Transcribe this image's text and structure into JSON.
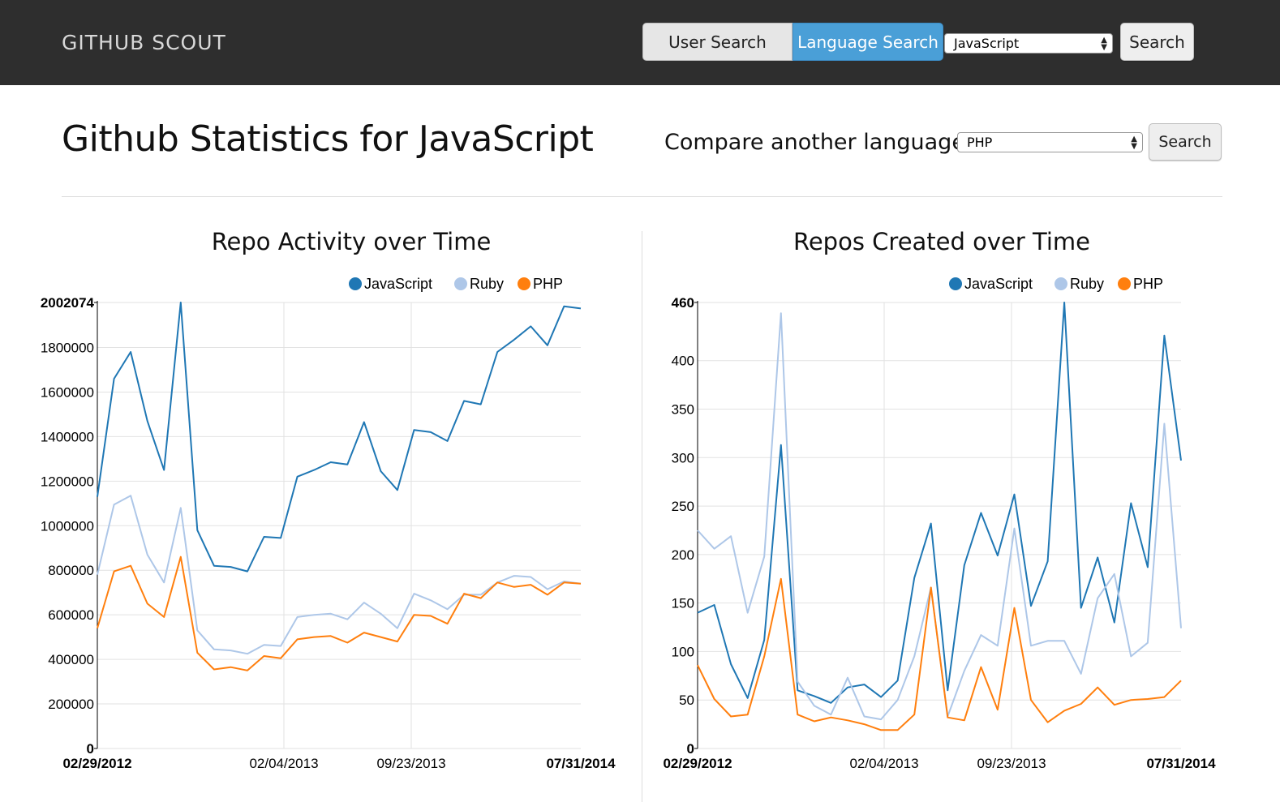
{
  "navbar": {
    "brand": "GITHUB SCOUT",
    "user_search_label": "User Search",
    "language_search_label": "Language Search",
    "language_select_value": "JavaScript",
    "search_button_label": "Search"
  },
  "page": {
    "title": "Github Statistics for JavaScript",
    "compare_label": "Compare another language:",
    "compare_select_value": "PHP",
    "compare_button_label": "Search"
  },
  "colors": {
    "javascript": "#1f77b4",
    "ruby": "#aec7e8",
    "php": "#ff7f0e",
    "navbar": "#2e2e2e",
    "active_tab": "#4a9fd7"
  },
  "chart_data": [
    {
      "type": "line",
      "title": "Repo Activity over Time",
      "legend": [
        "JavaScript",
        "Ruby",
        "PHP"
      ],
      "legend_position": "top-right",
      "ylim": [
        0,
        2002074
      ],
      "y_ticks": [
        "0",
        "200000",
        "400000",
        "600000",
        "800000",
        "1000000",
        "1200000",
        "1400000",
        "1600000",
        "1800000",
        "2002074"
      ],
      "x_ticks": [
        "02/29/2012",
        "02/04/2013",
        "09/23/2013",
        "07/31/2014"
      ],
      "x_points": 30,
      "grid": true,
      "series": [
        {
          "name": "JavaScript",
          "values": [
            1130000,
            1660000,
            1780000,
            1470000,
            1250000,
            2002074,
            980000,
            820000,
            815000,
            795000,
            950000,
            945000,
            1220000,
            1250000,
            1285000,
            1275000,
            1465000,
            1245000,
            1160000,
            1430000,
            1420000,
            1380000,
            1560000,
            1545000,
            1780000,
            1835000,
            1895000,
            1810000,
            1985000,
            1975000
          ]
        },
        {
          "name": "Ruby",
          "values": [
            780000,
            1095000,
            1135000,
            870000,
            745000,
            1080000,
            530000,
            445000,
            440000,
            425000,
            465000,
            460000,
            590000,
            600000,
            605000,
            580000,
            655000,
            605000,
            540000,
            695000,
            665000,
            625000,
            690000,
            690000,
            745000,
            775000,
            770000,
            715000,
            750000,
            740000
          ]
        },
        {
          "name": "PHP",
          "values": [
            540000,
            795000,
            820000,
            650000,
            590000,
            860000,
            430000,
            355000,
            365000,
            350000,
            415000,
            405000,
            490000,
            500000,
            505000,
            475000,
            520000,
            500000,
            480000,
            600000,
            595000,
            560000,
            695000,
            675000,
            745000,
            725000,
            735000,
            690000,
            745000,
            740000
          ]
        }
      ]
    },
    {
      "type": "line",
      "title": "Repos Created over Time",
      "legend": [
        "JavaScript",
        "Ruby",
        "PHP"
      ],
      "legend_position": "top-right",
      "ylim": [
        0,
        460
      ],
      "y_ticks": [
        "0",
        "50",
        "100",
        "150",
        "200",
        "250",
        "300",
        "350",
        "400",
        "460"
      ],
      "x_ticks": [
        "02/29/2012",
        "02/04/2013",
        "09/23/2013",
        "07/31/2014"
      ],
      "x_points": 30,
      "grid": true,
      "series": [
        {
          "name": "JavaScript",
          "values": [
            140,
            148,
            87,
            52,
            112,
            313,
            60,
            54,
            47,
            63,
            66,
            53,
            70,
            176,
            232,
            60,
            189,
            243,
            199,
            262,
            147,
            193,
            460,
            145,
            197,
            130,
            253,
            187,
            426,
            297
          ]
        },
        {
          "name": "Ruby",
          "values": [
            225,
            206,
            219,
            140,
            198,
            449,
            69,
            44,
            35,
            73,
            33,
            30,
            50,
            95,
            166,
            33,
            80,
            117,
            106,
            227,
            106,
            111,
            111,
            77,
            155,
            180,
            95,
            109,
            335,
            124
          ]
        },
        {
          "name": "PHP",
          "values": [
            86,
            51,
            33,
            35,
            95,
            175,
            35,
            28,
            32,
            29,
            25,
            19,
            19,
            35,
            166,
            32,
            29,
            84,
            40,
            145,
            50,
            27,
            39,
            46,
            63,
            45,
            50,
            51,
            53,
            70
          ]
        }
      ]
    }
  ]
}
